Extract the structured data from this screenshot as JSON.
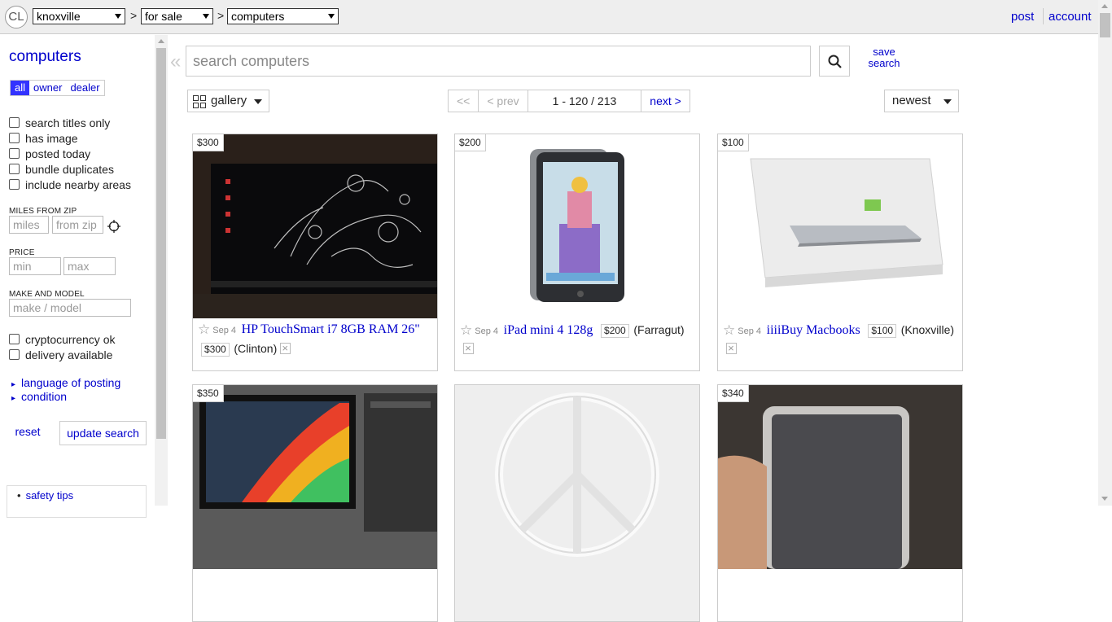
{
  "header": {
    "logo": "CL",
    "location": "knoxville",
    "category": "for sale",
    "subcategory": "computers",
    "sep": ">",
    "post": "post",
    "account": "account"
  },
  "sidebar": {
    "title": "computers",
    "filters": [
      "all",
      "owner",
      "dealer"
    ],
    "checks": [
      "search titles only",
      "has image",
      "posted today",
      "bundle duplicates",
      "include nearby areas"
    ],
    "miles_label": "MILES FROM ZIP",
    "miles_ph": "miles",
    "zip_ph": "from zip",
    "price_label": "PRICE",
    "min_ph": "min",
    "max_ph": "max",
    "make_label": "MAKE AND MODEL",
    "make_ph": "make / model",
    "checks2": [
      "cryptocurrency ok",
      "delivery available"
    ],
    "expand1": "language of posting",
    "expand2": "condition",
    "reset": "reset",
    "update": "update search",
    "safety": "safety tips"
  },
  "search": {
    "placeholder": "search computers",
    "save_line1": "save",
    "save_line2": "search",
    "collapse": "«"
  },
  "controls": {
    "view": "gallery",
    "first": "<<",
    "prev": "< prev",
    "range": "1 - 120 / 213",
    "next": "next >",
    "sort": "newest"
  },
  "listings": [
    {
      "price": "$300",
      "date": "Sep 4",
      "title": "HP TouchSmart i7 8GB RAM 26\"",
      "hood": "(Clinton)"
    },
    {
      "price": "$200",
      "date": "Sep 4",
      "title": "iPad mini 4 128g",
      "hood": "(Farragut)"
    },
    {
      "price": "$100",
      "date": "Sep 4",
      "title": "iiiiBuy Macbooks",
      "hood": "(Knoxville)"
    },
    {
      "price": "$350"
    },
    {
      "price": ""
    },
    {
      "price": "$340"
    }
  ]
}
